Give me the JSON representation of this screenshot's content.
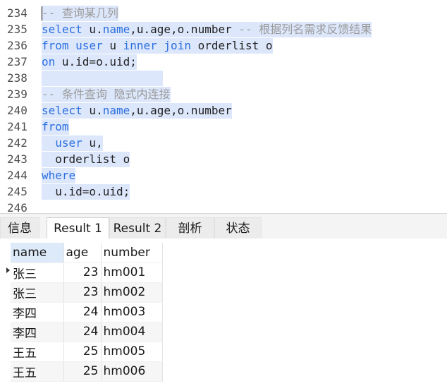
{
  "editor": {
    "lines": [
      {
        "no": "234",
        "tokens": [
          {
            "t": "-- 查询某几列",
            "c": "cm"
          }
        ]
      },
      {
        "no": "235",
        "tokens": [
          {
            "t": "select",
            "c": "kw"
          },
          {
            "t": " u.",
            "c": "pl"
          },
          {
            "t": "name",
            "c": "kw"
          },
          {
            "t": ",u.age,o.number ",
            "c": "pl"
          },
          {
            "t": "-- 根据列名需求反馈结果",
            "c": "cm"
          }
        ]
      },
      {
        "no": "236",
        "tokens": [
          {
            "t": "from",
            "c": "kw"
          },
          {
            "t": " ",
            "c": "pl"
          },
          {
            "t": "user",
            "c": "kw"
          },
          {
            "t": " u ",
            "c": "pl"
          },
          {
            "t": "inner",
            "c": "kw"
          },
          {
            "t": " ",
            "c": "pl"
          },
          {
            "t": "join",
            "c": "kw"
          },
          {
            "t": " orderlist o",
            "c": "pl"
          }
        ]
      },
      {
        "no": "237",
        "tokens": [
          {
            "t": "on",
            "c": "kw"
          },
          {
            "t": " u.id=o.uid;",
            "c": "pl"
          }
        ]
      },
      {
        "no": "238",
        "tokens": []
      },
      {
        "no": "239",
        "tokens": [
          {
            "t": "-- 条件查询 隐式内连接",
            "c": "cm"
          }
        ]
      },
      {
        "no": "240",
        "tokens": [
          {
            "t": "select",
            "c": "kw"
          },
          {
            "t": " u.",
            "c": "pl"
          },
          {
            "t": "name",
            "c": "kw"
          },
          {
            "t": ",u.age,o.number",
            "c": "pl"
          }
        ]
      },
      {
        "no": "241",
        "tokens": [
          {
            "t": "from",
            "c": "kw"
          }
        ]
      },
      {
        "no": "242",
        "tokens": [
          {
            "t": "  ",
            "c": "pl"
          },
          {
            "t": "user",
            "c": "kw"
          },
          {
            "t": " u,",
            "c": "pl"
          }
        ]
      },
      {
        "no": "243",
        "tokens": [
          {
            "t": "  orderlist o",
            "c": "pl"
          }
        ]
      },
      {
        "no": "244",
        "tokens": [
          {
            "t": "where",
            "c": "kw"
          }
        ]
      },
      {
        "no": "245",
        "tokens": [
          {
            "t": "  u.id=o.uid;",
            "c": "pl"
          }
        ]
      },
      {
        "no": "246",
        "tokens": null
      }
    ]
  },
  "tabs": [
    {
      "label": "信息",
      "active": false
    },
    {
      "label": "Result 1",
      "active": true
    },
    {
      "label": "Result 2",
      "active": false
    },
    {
      "label": "剖析",
      "active": false
    },
    {
      "label": "状态",
      "active": false
    }
  ],
  "result": {
    "columns": [
      "name",
      "age",
      "number"
    ],
    "rows": [
      [
        "张三",
        "23",
        "hm001"
      ],
      [
        "张三",
        "23",
        "hm002"
      ],
      [
        "李四",
        "24",
        "hm003"
      ],
      [
        "李四",
        "24",
        "hm004"
      ],
      [
        "王五",
        "25",
        "hm005"
      ],
      [
        "王五",
        "25",
        "hm006"
      ]
    ]
  },
  "colors": {
    "keyword": "#2b6fe0",
    "comment": "#9a9a9a",
    "selection": "#dde7fb",
    "header_highlight": "#ddeafa"
  }
}
